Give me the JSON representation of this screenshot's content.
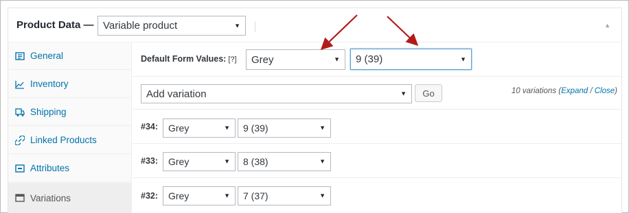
{
  "header": {
    "title": "Product Data —",
    "product_type": "Variable product"
  },
  "tabs": [
    {
      "label": "General",
      "icon": "general-icon"
    },
    {
      "label": "Inventory",
      "icon": "inventory-icon"
    },
    {
      "label": "Shipping",
      "icon": "shipping-icon"
    },
    {
      "label": "Linked Products",
      "icon": "link-icon"
    },
    {
      "label": "Attributes",
      "icon": "attributes-icon"
    },
    {
      "label": "Variations",
      "icon": "variations-icon",
      "active": true
    }
  ],
  "defaults": {
    "label": "Default Form Values:",
    "help": "[?]",
    "color": "Grey",
    "size": "9 (39)"
  },
  "add_variation": {
    "select": "Add variation",
    "go_label": "Go",
    "count_text": "10 variations",
    "open_paren": "(",
    "expand": "Expand",
    "sep": " / ",
    "close": "Close",
    "close_paren": ")"
  },
  "variations": [
    {
      "id": "#34:",
      "color": "Grey",
      "size": "9 (39)"
    },
    {
      "id": "#33:",
      "color": "Grey",
      "size": "8 (38)"
    },
    {
      "id": "#32:",
      "color": "Grey",
      "size": "7 (37)"
    }
  ],
  "colors": {
    "link": "#0073aa",
    "arrow": "#b31b1b"
  }
}
